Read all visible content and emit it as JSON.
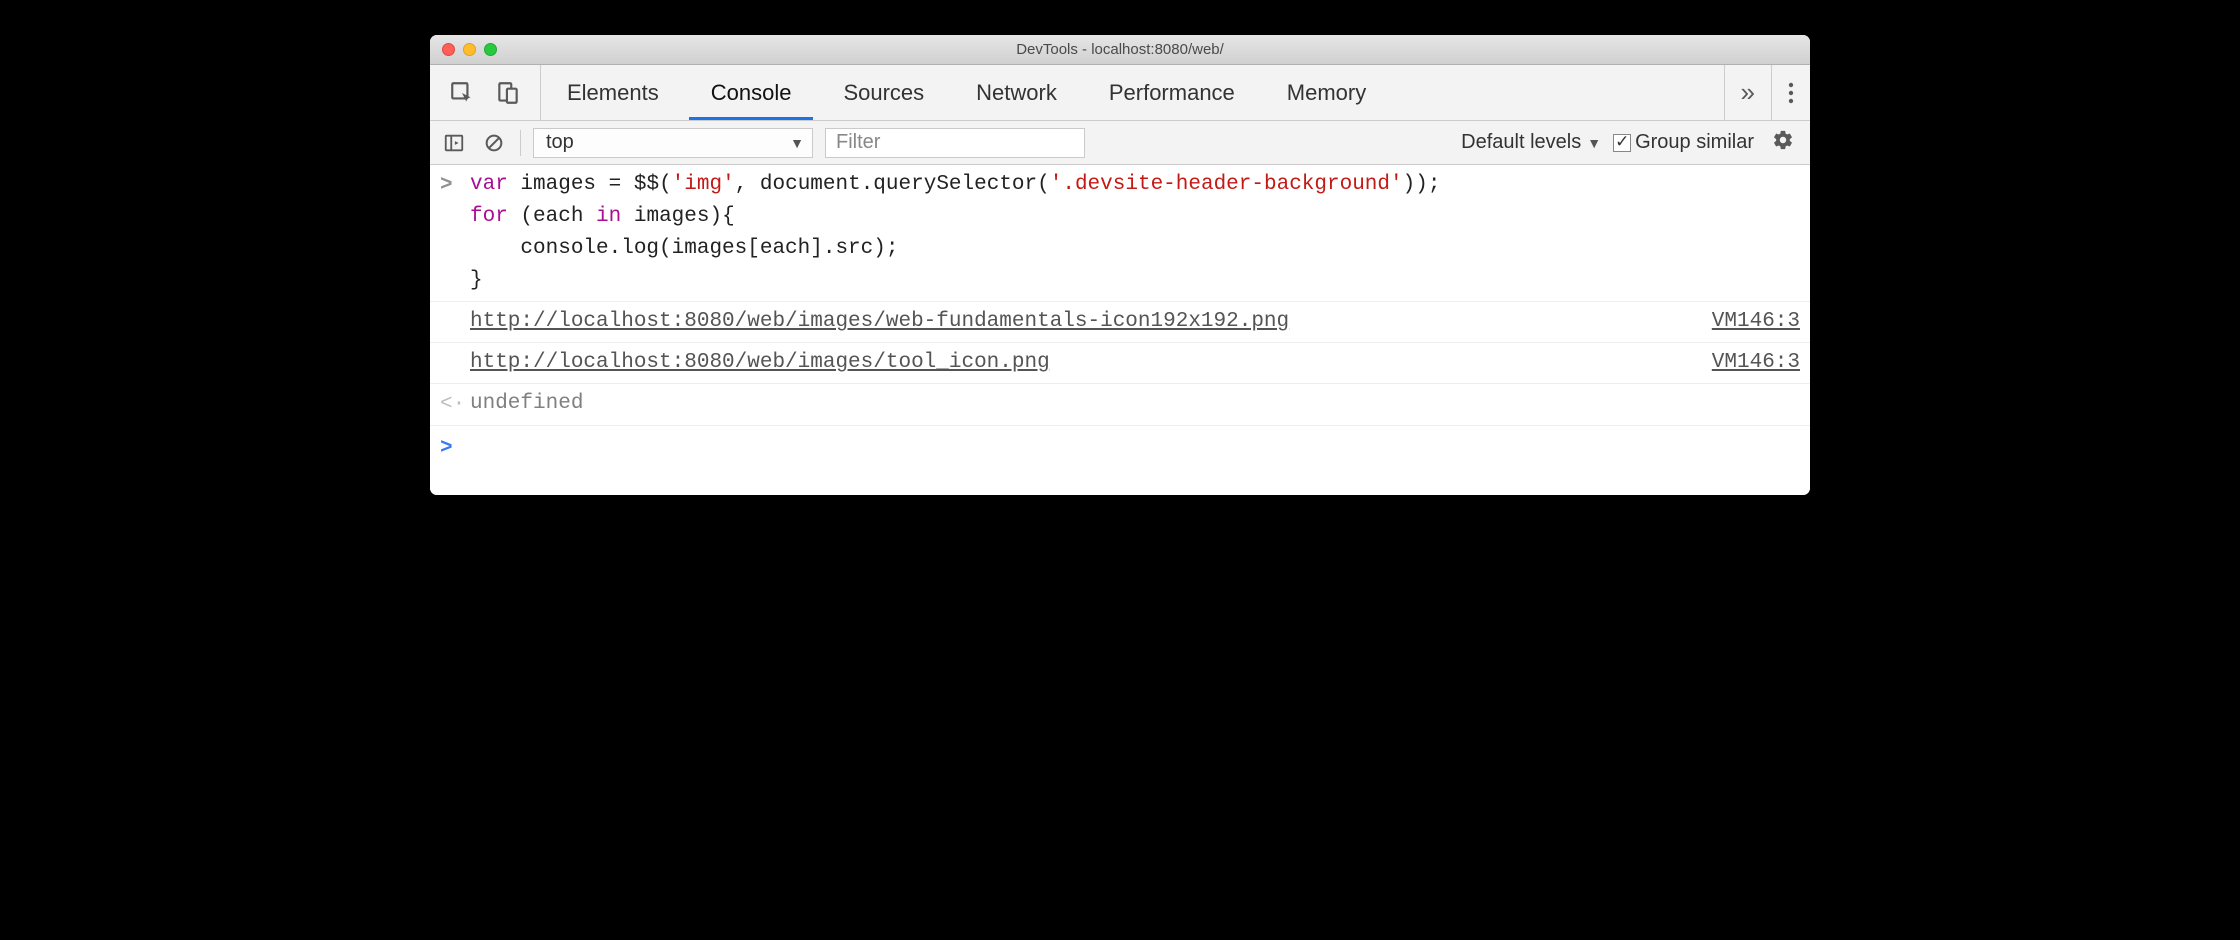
{
  "window": {
    "title": "DevTools - localhost:8080/web/"
  },
  "tabs": {
    "items": [
      {
        "label": "Elements"
      },
      {
        "label": "Console"
      },
      {
        "label": "Sources"
      },
      {
        "label": "Network"
      },
      {
        "label": "Performance"
      },
      {
        "label": "Memory"
      }
    ],
    "active_index": 1,
    "overflow_glyph": "»"
  },
  "toolbar": {
    "context": "top",
    "filter_placeholder": "Filter",
    "levels_label": "Default levels",
    "group_similar_label": "Group similar",
    "group_similar_checked": true
  },
  "console": {
    "input_marker": ">",
    "return_marker": "<·",
    "code_tokens": [
      {
        "t": "var ",
        "c": "kw"
      },
      {
        "t": "images ",
        "c": "pn"
      },
      {
        "t": "= ",
        "c": "pn"
      },
      {
        "t": "$$(",
        "c": "pn"
      },
      {
        "t": "'img'",
        "c": "str"
      },
      {
        "t": ", document.querySelector(",
        "c": "pn"
      },
      {
        "t": "'.devsite-header-background'",
        "c": "str"
      },
      {
        "t": "));\n",
        "c": "pn"
      },
      {
        "t": "for ",
        "c": "kw"
      },
      {
        "t": "(each ",
        "c": "pn"
      },
      {
        "t": "in ",
        "c": "kw"
      },
      {
        "t": "images){\n    console.log(images[each].src);\n}",
        "c": "pn"
      }
    ],
    "logs": [
      {
        "url": "http://localhost:8080/web/images/web-fundamentals-icon192x192.png",
        "source": "VM146:3"
      },
      {
        "url": "http://localhost:8080/web/images/tool_icon.png",
        "source": "VM146:3"
      }
    ],
    "return_value": "undefined",
    "prompt_marker": ">"
  }
}
